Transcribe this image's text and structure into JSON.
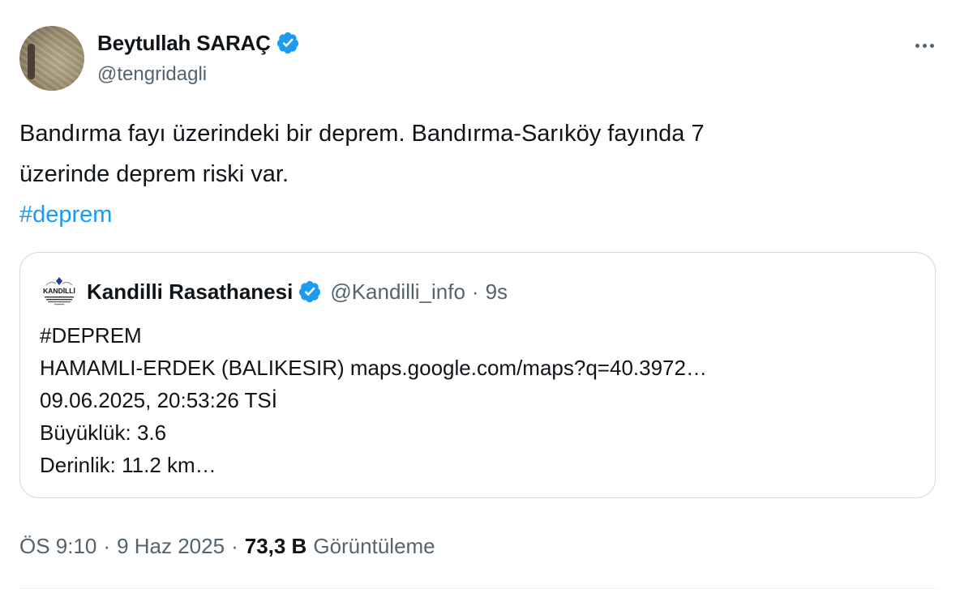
{
  "author": {
    "display_name": "Beytullah SARAÇ",
    "handle": "@tengridagli",
    "verified": true
  },
  "tweet": {
    "text_line1": "Bandırma fayı üzerindeki bir deprem. Bandırma-Sarıköy fayında 7",
    "text_line2": "üzerinde deprem riski var.",
    "hashtag": "#deprem"
  },
  "quote": {
    "display_name": "Kandilli Rasathanesi",
    "handle": "@Kandilli_info",
    "separator": "·",
    "time": "9s",
    "logo_text": "KANDİLLİ",
    "lines": [
      "#DEPREM",
      "HAMAMLI-ERDEK (BALIKESIR) maps.google.com/maps?q=40.3972…",
      "09.06.2025, 20:53:26 TSİ",
      "Büyüklük: 3.6",
      "Derinlik: 11.2 km…"
    ]
  },
  "meta": {
    "time": "ÖS 9:10",
    "separator": "·",
    "date": "9 Haz 2025",
    "views_count": "73,3 B",
    "views_label": "Görüntüleme"
  },
  "colors": {
    "accent": "#1d9bf0",
    "text": "#0f1419",
    "secondary": "#536471",
    "border": "#cfd9de"
  },
  "icons": {
    "verified": "verified-badge-icon",
    "more": "more-options-icon"
  }
}
